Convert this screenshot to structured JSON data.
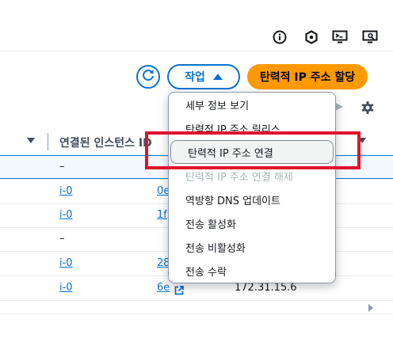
{
  "topbar": {
    "icons": [
      "info-icon",
      "feedback-icon",
      "console-icon",
      "screen-icon"
    ]
  },
  "toolbar": {
    "refresh_icon": "refresh-icon",
    "actions_label": "작업",
    "allocate_label": "탄력적 IP 주소 할당"
  },
  "table": {
    "column_header": "연결된 인스턴스 ID",
    "rows": [
      {
        "instance": "",
        "dash": "–",
        "tail": "",
        "ip": ""
      },
      {
        "instance": "i-0",
        "dash": "",
        "tail": "0e",
        "ip": ""
      },
      {
        "instance": "i-0",
        "dash": "",
        "tail": "1f",
        "ip": ""
      },
      {
        "instance": "",
        "dash": "–",
        "tail": "",
        "ip": ""
      },
      {
        "instance": "i-0",
        "dash": "",
        "tail": "28",
        "ip": ""
      },
      {
        "instance": "i-0",
        "dash": "",
        "tail": "6e",
        "ip": "172.31.15.6"
      }
    ]
  },
  "menu": {
    "items": [
      {
        "label": "세부 정보 보기",
        "disabled": false
      },
      {
        "label": "탄력적 IP 주소 릴리스",
        "disabled": false
      },
      {
        "label": "탄력적 IP 주소 연결",
        "disabled": false,
        "highlighted": true
      },
      {
        "label": "탄력적 IP 주소 연결 해제",
        "disabled": true
      },
      {
        "label": "역방향 DNS 업데이트",
        "disabled": false
      },
      {
        "label": "전송 활성화",
        "disabled": false
      },
      {
        "label": "전송 비활성화",
        "disabled": false
      },
      {
        "label": "전송 수락",
        "disabled": false
      }
    ]
  },
  "colors": {
    "accent": "#0972d3",
    "primary": "#ff9900",
    "highlight_outline": "#e0132b"
  }
}
